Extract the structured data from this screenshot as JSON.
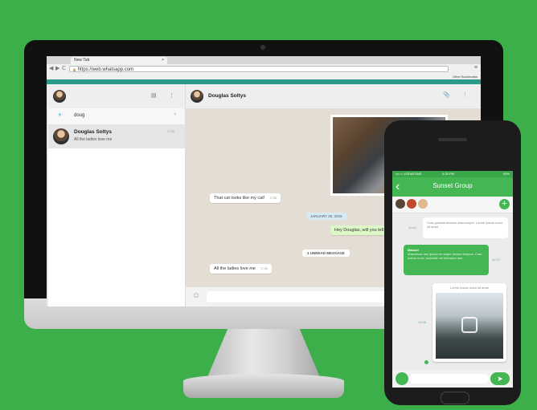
{
  "browser": {
    "tab_title": "New Tab",
    "tab_close": "×",
    "url": "https://web.whatsapp.com",
    "other_bookmarks": "Other Bookmarks",
    "back_icon": "◀",
    "forward_icon": "▶",
    "reload_icon": "C",
    "lock_icon": "🔒",
    "menu_icon": "≡"
  },
  "sidebar": {
    "search_value": "doug",
    "search_clear": "×",
    "chat_icon": "▤",
    "menu_icon": "⋮",
    "chats": [
      {
        "name": "Douglas Soltys",
        "preview": "All the ladies love me",
        "time": "17:58"
      }
    ]
  },
  "conversation": {
    "contact_name": "Douglas Soltys",
    "attach_icon": "📎",
    "menu_icon": "⋮",
    "messages": [
      {
        "text": "That cat looks like my cat!",
        "time": "17:58"
      },
      {
        "text": "Hey Douglas, will you tell",
        "time": ""
      },
      {
        "text": "All the ladies love me",
        "time": "17:58"
      }
    ],
    "date_divider": "JANUARY 25, 2015",
    "unread_divider": "1 UNREAD MESSAGE",
    "emoji_icon": "☺"
  },
  "phone": {
    "status_left": "•••○○ VODAFONE",
    "status_time": "4:28 PM",
    "status_right": "59%",
    "title": "Sunset Group",
    "back_icon": "‹",
    "add_icon": "+",
    "messages": [
      {
        "time": "10:41",
        "text": "Cras gravida tenetus ullamcorper. Lorem ipsum dolor sit amet."
      },
      {
        "sender": "Manuel",
        "time": "11:02",
        "text": "Maecenas nec ipsum et neque dictum tempus. Cras metus nunc, molestie vel interdum nec."
      },
      {
        "time": "10:55",
        "caption": "Lorem ipsum dolor sit amet"
      }
    ],
    "send_icon": "➤"
  },
  "colors": {
    "background": "#3daf4a",
    "whatsapp_teal": "#2a9b8b",
    "whatsapp_green": "#45b654"
  }
}
